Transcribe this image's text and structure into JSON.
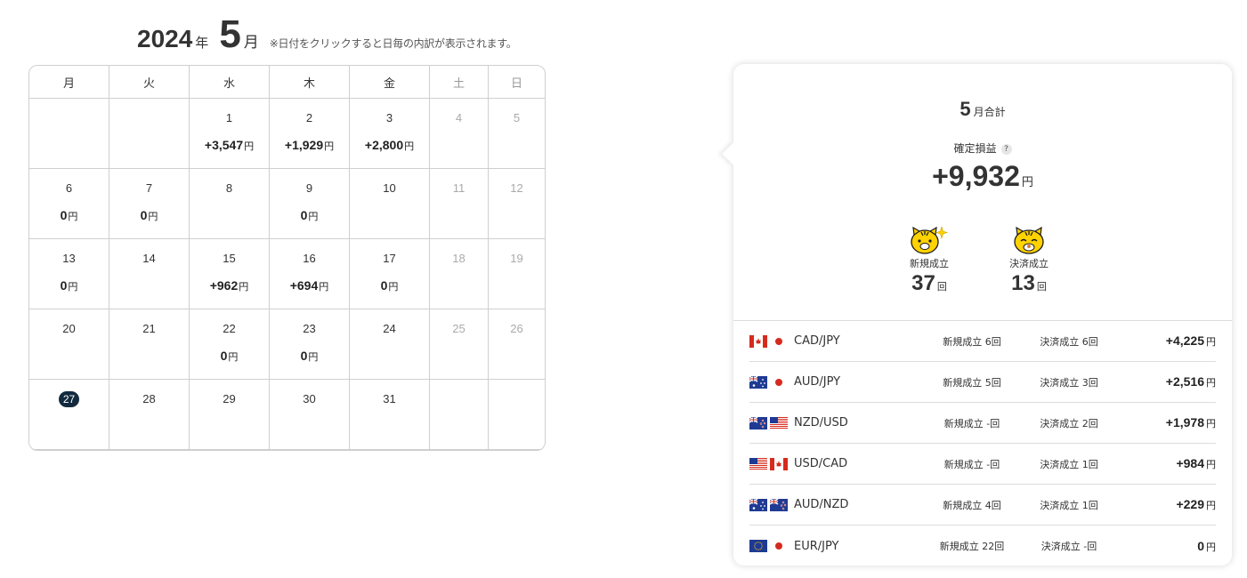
{
  "calendar": {
    "year": "2024",
    "year_unit": "年",
    "month": "5",
    "month_unit": "月",
    "note": "※日付をクリックすると日毎の内訳が表示されます。",
    "weekdays": [
      "月",
      "火",
      "水",
      "木",
      "金",
      "土",
      "日"
    ],
    "currency_unit": "円",
    "today": "27",
    "weeks": [
      [
        null,
        null,
        {
          "day": "1",
          "value": "+3,547"
        },
        {
          "day": "2",
          "value": "+1,929"
        },
        {
          "day": "3",
          "value": "+2,800"
        },
        {
          "day": "4"
        },
        {
          "day": "5"
        }
      ],
      [
        {
          "day": "6",
          "value": "0"
        },
        {
          "day": "7",
          "value": "0"
        },
        {
          "day": "8"
        },
        {
          "day": "9",
          "value": "0"
        },
        {
          "day": "10"
        },
        {
          "day": "11"
        },
        {
          "day": "12"
        }
      ],
      [
        {
          "day": "13",
          "value": "0"
        },
        {
          "day": "14"
        },
        {
          "day": "15",
          "value": "+962"
        },
        {
          "day": "16",
          "value": "+694"
        },
        {
          "day": "17",
          "value": "0"
        },
        {
          "day": "18"
        },
        {
          "day": "19"
        }
      ],
      [
        {
          "day": "20"
        },
        {
          "day": "21"
        },
        {
          "day": "22",
          "value": "0"
        },
        {
          "day": "23",
          "value": "0"
        },
        {
          "day": "24"
        },
        {
          "day": "25"
        },
        {
          "day": "26"
        }
      ],
      [
        {
          "day": "27"
        },
        {
          "day": "28"
        },
        {
          "day": "29"
        },
        {
          "day": "30"
        },
        {
          "day": "31"
        },
        null,
        null
      ]
    ]
  },
  "summary": {
    "month": "5",
    "month_label": "月合計",
    "profit_label": "確定損益",
    "help_icon": "?",
    "profit_value": "+9,932",
    "profit_unit": "円",
    "new_label": "新規成立",
    "new_count": "37",
    "settle_label": "決済成立",
    "settle_count": "13",
    "count_unit": "回"
  },
  "pairs": [
    {
      "name": "CAD/JPY",
      "flags": [
        "ca",
        "jp"
      ],
      "new": "新規成立 6回",
      "settle": "決済成立 6回",
      "profit": "+4,225",
      "unit": "円"
    },
    {
      "name": "AUD/JPY",
      "flags": [
        "au",
        "jp"
      ],
      "new": "新規成立 5回",
      "settle": "決済成立 3回",
      "profit": "+2,516",
      "unit": "円"
    },
    {
      "name": "NZD/USD",
      "flags": [
        "nz",
        "us"
      ],
      "new": "新規成立 -回",
      "settle": "決済成立 2回",
      "profit": "+1,978",
      "unit": "円"
    },
    {
      "name": "USD/CAD",
      "flags": [
        "us",
        "ca"
      ],
      "new": "新規成立 -回",
      "settle": "決済成立 1回",
      "profit": "+984",
      "unit": "円"
    },
    {
      "name": "AUD/NZD",
      "flags": [
        "au",
        "nz"
      ],
      "new": "新規成立 4回",
      "settle": "決済成立 1回",
      "profit": "+229",
      "unit": "円"
    },
    {
      "name": "EUR/JPY",
      "flags": [
        "eu",
        "jp"
      ],
      "new": "新規成立 22回",
      "settle": "決済成立 -回",
      "profit": "0",
      "unit": "円"
    }
  ],
  "colors": {
    "today_badge": "#132a3e",
    "mascot_yellow": "#ffd200",
    "flag_red": "#d52b1e",
    "flag_blue": "#1f3a93"
  }
}
